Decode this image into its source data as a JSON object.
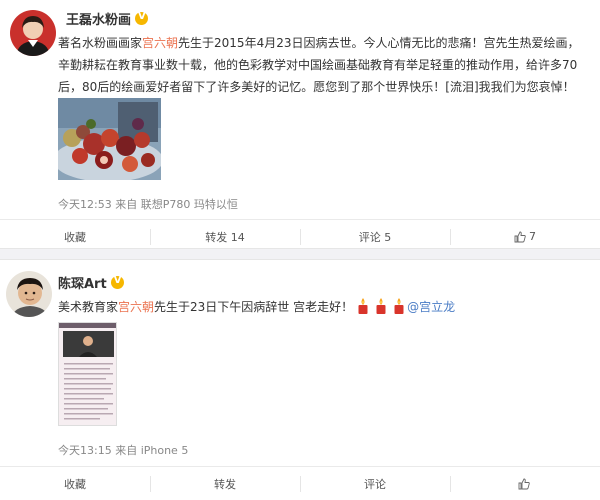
{
  "post1": {
    "author": "王磊水粉画",
    "text_before_name": "著名水粉画画家",
    "highlight_name": "宫六朝",
    "text_line1_after": "先生于2015年4月23日因病去世。今人心情无比的悲痛！宫先生热爱绘画，",
    "text_line2": "辛勤耕耘在教育事业数十载，他的色彩教学对中国绘画基础教育有举足轻重的推动作用，给许多70",
    "text_line3": "后，80后的绘画爱好者留下了许多美好的记忆。愿您到了那个世界快乐！[流泪]我我们为您哀悼！",
    "meta": "今天12:53 来自 联想P780 玛特以恒",
    "actions": {
      "favorite": "收藏",
      "repost": "转发 14",
      "comment": "评论 5",
      "like_count": "7"
    }
  },
  "post2": {
    "author": "陈琛Art",
    "text_before_name": "美术教育家",
    "highlight_name": "宫六朝",
    "text_after": "先生于23日下午因病辞世 宫老走好！",
    "mention": "@宫立龙",
    "meta": "今天13:15 来自 iPhone 5",
    "actions": {
      "favorite": "收藏",
      "repost": "转发",
      "comment": "评论",
      "like_count": ""
    }
  },
  "colors": {
    "highlight": "#eb7350",
    "mention": "#4a7cc5",
    "vbadge": "#f6b700",
    "divider": "#f2f2f5"
  },
  "icons": [
    "verified-badge-icon",
    "like-thumb-icon",
    "candle-icon"
  ]
}
